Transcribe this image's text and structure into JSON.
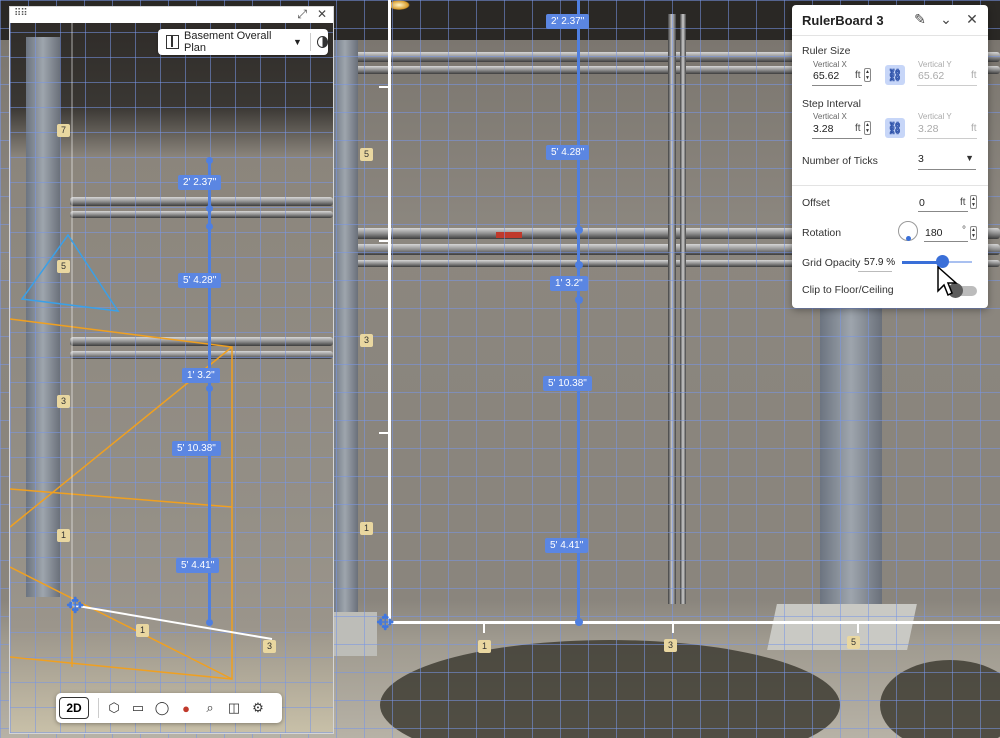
{
  "panel": {
    "title": "RulerBoard 3",
    "icons": {
      "edit": "pencil-icon",
      "collapse": "chevron-down-icon",
      "close": "close-icon"
    },
    "ruler_size": {
      "label": "Ruler Size",
      "vx_label": "Vertical X",
      "vx_value": "65.62",
      "vx_unit": "ft",
      "vy_label": "Vertical Y",
      "vy_value": "65.62",
      "vy_unit": "ft"
    },
    "step_interval": {
      "label": "Step Interval",
      "vx_label": "Vertical X",
      "vx_value": "3.28",
      "vx_unit": "ft",
      "vy_label": "Vertical Y",
      "vy_value": "3.28",
      "vy_unit": "ft"
    },
    "ticks": {
      "label": "Number of Ticks",
      "value": "3"
    },
    "offset": {
      "label": "Offset",
      "value": "0",
      "unit": "ft"
    },
    "rotation": {
      "label": "Rotation",
      "value": "180",
      "unit": "°"
    },
    "grid_opacity": {
      "label": "Grid Opacity",
      "value": "57.9 %",
      "fraction": 0.579
    },
    "clip": {
      "label": "Clip to Floor/Ceiling",
      "enabled": false
    }
  },
  "plan_selector": {
    "label": "Basement Overall Plan"
  },
  "toolbar": {
    "mode_2d": "2D"
  },
  "main_ruler": {
    "labels": [
      "2' 2.37\"",
      "5' 4.28\"",
      "1' 3.2\"",
      "5' 10.38\"",
      "5' 4.41\""
    ]
  },
  "inset_ruler": {
    "labels": [
      "2' 2.37\"",
      "5' 4.28\"",
      "1' 3.2\"",
      "5' 10.38\"",
      "5' 4.41\""
    ]
  },
  "main_badges": {
    "v5": "5",
    "v3": "3",
    "v1": "1",
    "h1": "1",
    "h3": "3",
    "h5": "5"
  },
  "inset_badges": {
    "v7": "7",
    "v5": "5",
    "v3": "3",
    "v1": "1",
    "h1": "1",
    "h3": "3"
  }
}
